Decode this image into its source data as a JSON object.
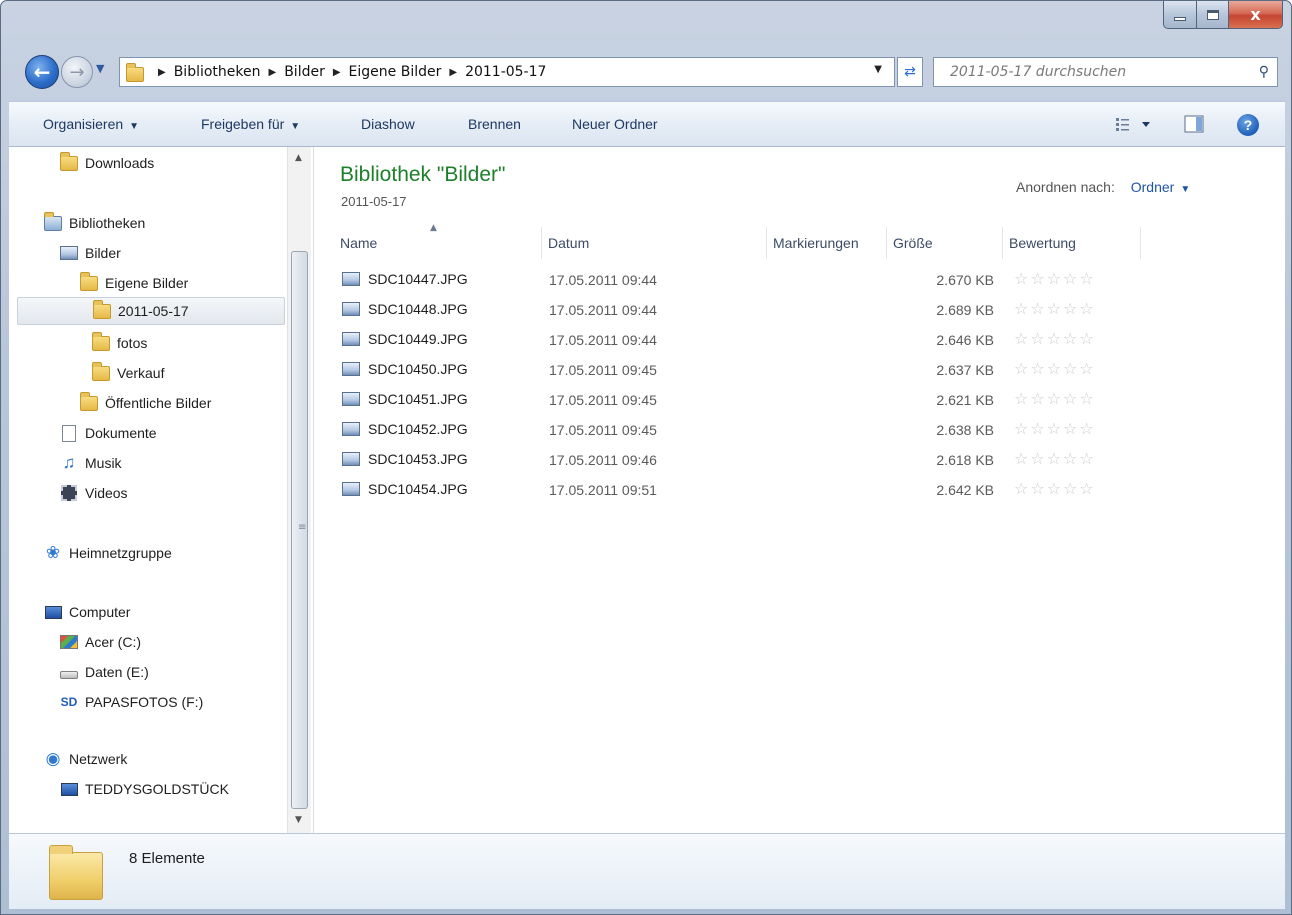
{
  "window": {
    "controls": {
      "minimize": "—",
      "maximize": "□",
      "close": "x"
    }
  },
  "address": {
    "crumbs": [
      "Bibliotheken",
      "Bilder",
      "Eigene Bilder",
      "2011-05-17"
    ],
    "search_placeholder": "2011-05-17 durchsuchen"
  },
  "toolbar": {
    "organize": "Organisieren",
    "share": "Freigeben für",
    "slideshow": "Diashow",
    "burn": "Brennen",
    "new_folder": "Neuer Ordner",
    "help": "?"
  },
  "sidebar": {
    "items": [
      {
        "label": "Downloads",
        "icon": "downloads-folder-icon"
      },
      {
        "label": "Bibliotheken",
        "icon": "libraries-icon"
      },
      {
        "label": "Bilder",
        "icon": "pictures-library-icon"
      },
      {
        "label": "Eigene Bilder",
        "icon": "pictures-folder-icon"
      },
      {
        "label": "2011-05-17",
        "icon": "folder-icon",
        "selected": true
      },
      {
        "label": "fotos",
        "icon": "folder-icon"
      },
      {
        "label": "Verkauf",
        "icon": "folder-icon"
      },
      {
        "label": "Öffentliche Bilder",
        "icon": "folder-icon"
      },
      {
        "label": "Dokumente",
        "icon": "documents-icon"
      },
      {
        "label": "Musik",
        "icon": "music-icon"
      },
      {
        "label": "Videos",
        "icon": "videos-icon"
      },
      {
        "label": "Heimnetzgruppe",
        "icon": "homegroup-icon"
      },
      {
        "label": "Computer",
        "icon": "computer-icon"
      },
      {
        "label": "Acer (C:)",
        "icon": "system-drive-icon"
      },
      {
        "label": "Daten (E:)",
        "icon": "drive-icon"
      },
      {
        "label": "PAPASFOTOS (F:)",
        "icon": "sd-card-icon"
      },
      {
        "label": "Netzwerk",
        "icon": "network-icon"
      },
      {
        "label": "TEDDYSGOLDSTÜCK",
        "icon": "network-computer-icon"
      }
    ]
  },
  "content": {
    "title": "Bibliothek \"Bilder\"",
    "subtitle": "2011-05-17",
    "arrange_label": "Anordnen nach:",
    "arrange_value": "Ordner",
    "columns": [
      "Name",
      "Datum",
      "Markierungen",
      "Größe",
      "Bewertung"
    ],
    "files": [
      {
        "name": "SDC10447.JPG",
        "date": "17.05.2011 09:44",
        "size": "2.670 KB",
        "rating": 0
      },
      {
        "name": "SDC10448.JPG",
        "date": "17.05.2011 09:44",
        "size": "2.689 KB",
        "rating": 0
      },
      {
        "name": "SDC10449.JPG",
        "date": "17.05.2011 09:44",
        "size": "2.646 KB",
        "rating": 0
      },
      {
        "name": "SDC10450.JPG",
        "date": "17.05.2011 09:45",
        "size": "2.637 KB",
        "rating": 0
      },
      {
        "name": "SDC10451.JPG",
        "date": "17.05.2011 09:45",
        "size": "2.621 KB",
        "rating": 0
      },
      {
        "name": "SDC10452.JPG",
        "date": "17.05.2011 09:45",
        "size": "2.638 KB",
        "rating": 0
      },
      {
        "name": "SDC10453.JPG",
        "date": "17.05.2011 09:46",
        "size": "2.618 KB",
        "rating": 0
      },
      {
        "name": "SDC10454.JPG",
        "date": "17.05.2011 09:51",
        "size": "2.642 KB",
        "rating": 0
      }
    ]
  },
  "status": {
    "count_text": "8 Elemente"
  },
  "colors": {
    "title_green": "#1e7f2a",
    "link_blue": "#1e54a8"
  }
}
